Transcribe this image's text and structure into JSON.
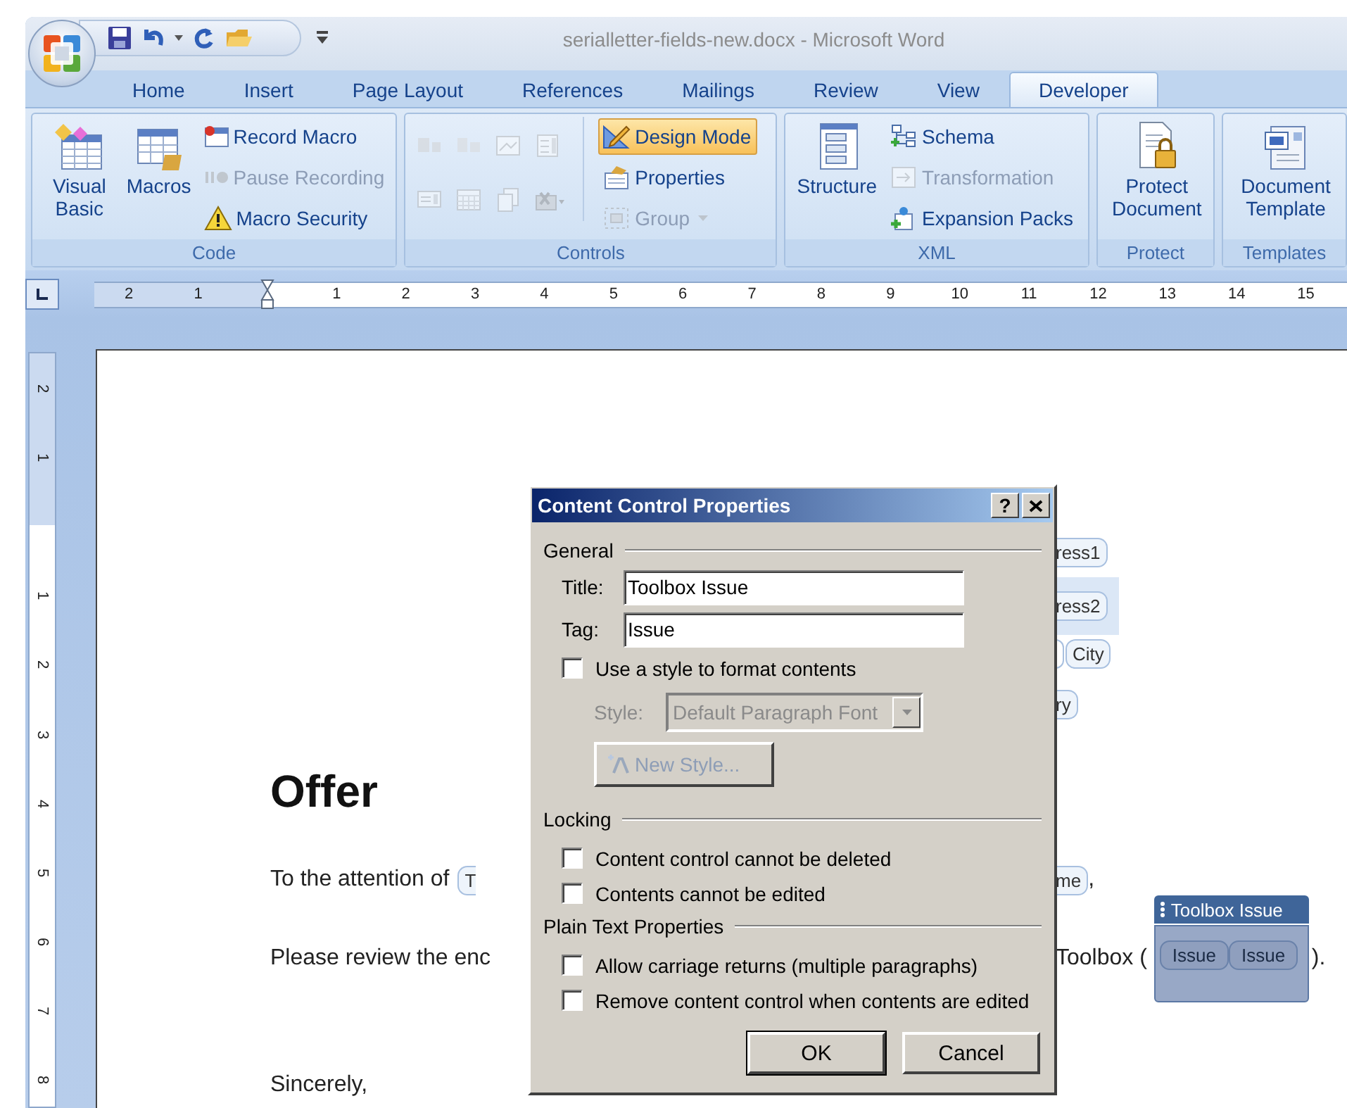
{
  "window": {
    "title": "serialletter-fields-new.docx - Microsoft Word"
  },
  "tabs": [
    {
      "label": "Home",
      "selected": false
    },
    {
      "label": "Insert",
      "selected": false
    },
    {
      "label": "Page Layout",
      "selected": false
    },
    {
      "label": "References",
      "selected": false
    },
    {
      "label": "Mailings",
      "selected": false
    },
    {
      "label": "Review",
      "selected": false
    },
    {
      "label": "View",
      "selected": false
    },
    {
      "label": "Developer",
      "selected": true
    }
  ],
  "ribbon": {
    "groups": [
      {
        "label": "Code",
        "items": [
          {
            "kind": "large",
            "label": "Visual Basic",
            "disabled": false,
            "active": false
          },
          {
            "kind": "large",
            "label": "Macros",
            "disabled": false,
            "active": false
          },
          {
            "kind": "small",
            "label": "Record Macro",
            "disabled": false,
            "active": false,
            "dropdown": false
          },
          {
            "kind": "small",
            "label": "Pause Recording",
            "disabled": true,
            "active": false,
            "dropdown": false
          },
          {
            "kind": "small",
            "label": "Macro Security",
            "disabled": false,
            "active": false,
            "dropdown": false
          }
        ]
      },
      {
        "label": "Controls",
        "items": [
          {
            "kind": "icon",
            "disabled": true,
            "active": false
          },
          {
            "kind": "icon",
            "disabled": true,
            "active": false
          },
          {
            "kind": "icon",
            "disabled": true,
            "active": false
          },
          {
            "kind": "icon",
            "disabled": true,
            "active": false
          },
          {
            "kind": "icon",
            "disabled": true,
            "active": false
          },
          {
            "kind": "icon",
            "disabled": true,
            "active": false
          },
          {
            "kind": "icon",
            "disabled": true,
            "active": false
          },
          {
            "kind": "icon",
            "disabled": true,
            "active": false
          },
          {
            "kind": "small",
            "label": "Design Mode",
            "disabled": false,
            "active": true,
            "dropdown": false
          },
          {
            "kind": "small",
            "label": "Properties",
            "disabled": false,
            "active": false,
            "dropdown": false
          },
          {
            "kind": "small",
            "label": "Group",
            "disabled": true,
            "active": false,
            "dropdown": true
          }
        ]
      },
      {
        "label": "XML",
        "items": [
          {
            "kind": "large",
            "label": "Structure",
            "disabled": false,
            "active": false
          },
          {
            "kind": "small",
            "label": "Schema",
            "disabled": false,
            "active": false,
            "dropdown": false
          },
          {
            "kind": "small",
            "label": "Transformation",
            "disabled": true,
            "active": false,
            "dropdown": false
          },
          {
            "kind": "small",
            "label": "Expansion Packs",
            "disabled": false,
            "active": false,
            "dropdown": false
          }
        ]
      },
      {
        "label": "Protect",
        "items": [
          {
            "kind": "large",
            "label": "Protect Document",
            "disabled": false,
            "active": false
          }
        ]
      },
      {
        "label": "Templates",
        "items": [
          {
            "kind": "large",
            "label": "Document Template",
            "disabled": false,
            "active": false
          }
        ]
      }
    ]
  },
  "ruler": {
    "marks": [
      "2",
      "1",
      "1",
      "2",
      "3",
      "4",
      "5",
      "6",
      "7",
      "8",
      "9",
      "10",
      "11",
      "12",
      "13",
      "14",
      "15"
    ]
  },
  "vertical_ruler": {
    "marks": [
      "2",
      "1",
      "1",
      "2",
      "3",
      "4",
      "5",
      "6",
      "7",
      "8"
    ]
  },
  "document": {
    "rows": [
      {
        "kind": "field",
        "left": [],
        "right": [
          {
            "kind": "chip",
            "text": "ress1",
            "selected": false
          }
        ]
      },
      {
        "kind": "field",
        "left": [],
        "right": [
          {
            "kind": "chip",
            "text": "ress2",
            "selected": true
          }
        ]
      },
      {
        "kind": "field",
        "left": [],
        "right": [
          {
            "kind": "chip-end"
          },
          {
            "kind": "chip",
            "text": "City",
            "selected": false
          }
        ]
      },
      {
        "kind": "field",
        "left": [],
        "right": [
          {
            "kind": "chip",
            "text": "ry",
            "selected": false
          }
        ]
      },
      {
        "kind": "heading",
        "left": [
          {
            "kind": "text",
            "text": "Offer"
          }
        ],
        "right": []
      },
      {
        "kind": "para",
        "left": [
          {
            "kind": "text",
            "text": "To the attention of"
          },
          {
            "kind": "chip",
            "text": "T",
            "selected": false
          }
        ],
        "right": [
          {
            "kind": "chip",
            "text": "me",
            "selected": false
          },
          {
            "kind": "text",
            "text": ","
          }
        ]
      },
      {
        "kind": "para",
        "left": [
          {
            "kind": "text",
            "text": "Please review the enc"
          }
        ],
        "right": [
          {
            "kind": "text",
            "text": "Toolbox ("
          },
          {
            "kind": "control",
            "title": "Toolbox Issue",
            "chips": [
              "Issue",
              "Issue"
            ]
          },
          {
            "kind": "text",
            "text": ")."
          }
        ]
      },
      {
        "kind": "closing",
        "left": [
          {
            "kind": "text",
            "text": "Sincerely,"
          }
        ],
        "right": []
      }
    ]
  },
  "dialog": {
    "title": "Content Control Properties",
    "help": "?",
    "sections": [
      {
        "heading": "General",
        "controls": [
          {
            "kind": "field",
            "label": "Title:",
            "value": "Toolbox Issue"
          },
          {
            "kind": "field",
            "label": "Tag:",
            "value": "Issue"
          },
          {
            "kind": "checkbox",
            "label": "Use a style to format contents",
            "checked": false
          },
          {
            "kind": "select",
            "label": "Style:",
            "value": "Default Paragraph Font",
            "disabled": true
          },
          {
            "kind": "button",
            "label": "New Style...",
            "disabled": true
          }
        ]
      },
      {
        "heading": "Locking",
        "controls": [
          {
            "kind": "checkbox",
            "label": "Content control cannot be deleted",
            "checked": false
          },
          {
            "kind": "checkbox",
            "label": "Contents cannot be edited",
            "checked": false
          }
        ]
      },
      {
        "heading": "Plain Text Properties",
        "controls": [
          {
            "kind": "checkbox",
            "label": "Allow carriage returns (multiple paragraphs)",
            "checked": false
          },
          {
            "kind": "checkbox",
            "label": "Remove content control when contents are edited",
            "checked": false
          }
        ]
      }
    ],
    "buttons": [
      {
        "label": "OK",
        "default": true
      },
      {
        "label": "Cancel",
        "default": false
      }
    ]
  }
}
